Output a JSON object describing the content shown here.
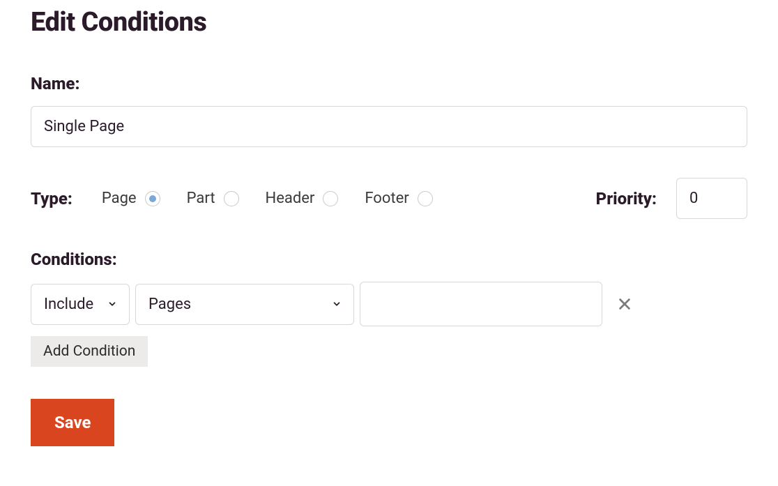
{
  "page_title": "Edit Conditions",
  "name_field": {
    "label": "Name:",
    "value": "Single Page"
  },
  "type_field": {
    "label": "Type:",
    "options": [
      "Page",
      "Part",
      "Header",
      "Footer"
    ],
    "selected": "Page"
  },
  "priority_field": {
    "label": "Priority:",
    "value": "0"
  },
  "conditions_section": {
    "label": "Conditions:",
    "rows": [
      {
        "mode": "Include",
        "target": "Pages",
        "value": ""
      }
    ],
    "add_button_label": "Add Condition"
  },
  "save_button_label": "Save"
}
